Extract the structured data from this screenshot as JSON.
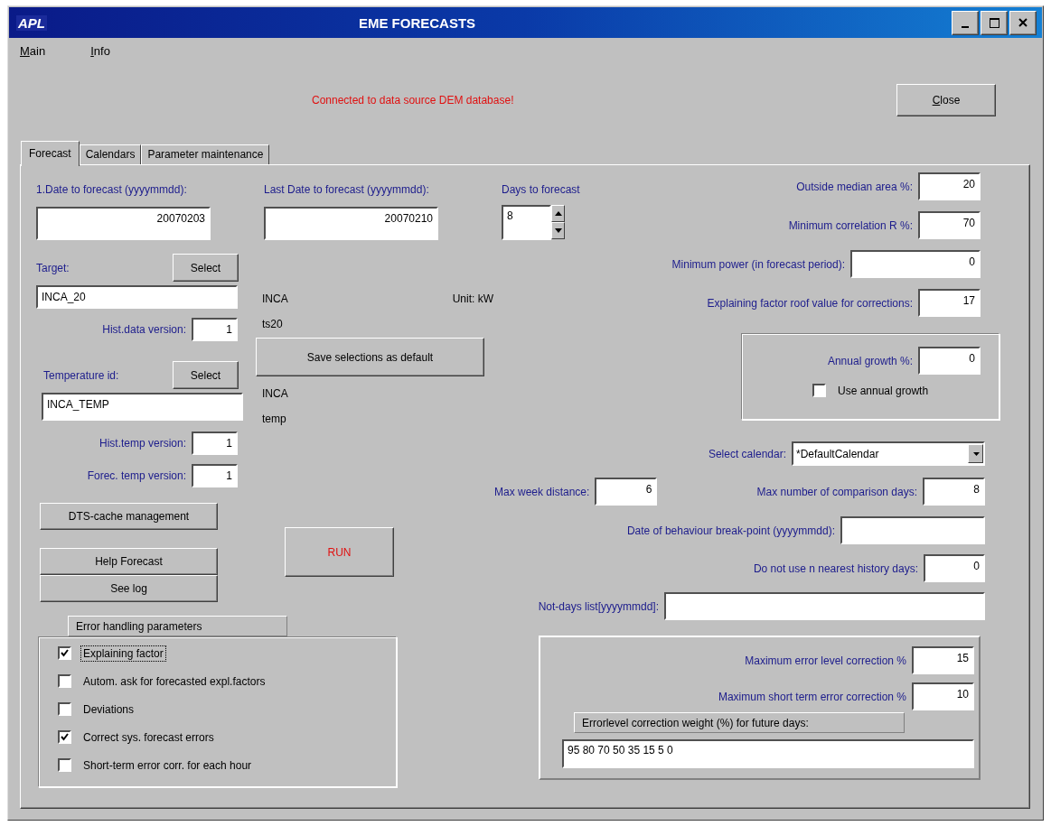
{
  "window": {
    "logo": "APL",
    "title": "EME FORECASTS"
  },
  "menu": [
    {
      "label": "Main"
    },
    {
      "label": "Info"
    }
  ],
  "status_message": "Connected to data source DEM database!",
  "close_button": "Close",
  "tabs": [
    {
      "label": "Forecast",
      "selected": true
    },
    {
      "label": "Calendars",
      "selected": false
    },
    {
      "label": "Parameter maintenance",
      "selected": false
    }
  ],
  "forecast": {
    "first_date": {
      "label": "1.Date to forecast (yyyymmdd):",
      "value": "20070203"
    },
    "last_date": {
      "label": "Last Date to forecast (yyyymmdd):",
      "value": "20070210"
    },
    "days_to_forecast": {
      "label": "Days to forecast",
      "value": "8"
    },
    "target": {
      "label": "Target:",
      "button": "Select",
      "value": "INCA_20",
      "name": "INCA",
      "unit": "Unit: kW",
      "series": "ts20"
    },
    "hist_data_version": {
      "label": "Hist.data version:",
      "value": "1"
    },
    "save_button": "Save selections as default",
    "temperature": {
      "label": "Temperature id:",
      "button": "Select",
      "value": "INCA_TEMP",
      "name": "INCA",
      "series": "temp"
    },
    "hist_temp_version": {
      "label": "Hist.temp version:",
      "value": "1"
    },
    "forec_temp_version": {
      "label": "Forec. temp version:",
      "value": "1"
    },
    "dts_button": "DTS-cache management",
    "help_button": "Help Forecast",
    "log_button": "See log",
    "run_button": "RUN",
    "error_handling": {
      "title": "Error handling parameters",
      "options": [
        {
          "label": "Explaining factor",
          "checked": true,
          "focused": true
        },
        {
          "label": "Autom. ask for forecasted expl.factors",
          "checked": false,
          "focused": false
        },
        {
          "label": "Deviations",
          "checked": false,
          "focused": false
        },
        {
          "label": "Correct sys. forecast errors",
          "checked": true,
          "focused": false
        },
        {
          "label": "Short-term error corr. for each hour",
          "checked": false,
          "focused": false
        }
      ]
    },
    "params": [
      {
        "label": "Outside median area %:",
        "value": "20",
        "kind": "short"
      },
      {
        "label": "Minimum correlation R %:",
        "value": "70",
        "kind": "short"
      },
      {
        "label": "Minimum power (in forecast period):",
        "value": "0",
        "kind": "wide"
      },
      {
        "label": "Explaining factor roof value for corrections:",
        "value": "17",
        "kind": "short"
      }
    ],
    "annual_growth": {
      "label": "Annual growth %:",
      "value": "0",
      "checkbox": {
        "label": "Use annual growth",
        "checked": false
      }
    },
    "calendar": {
      "label": "Select calendar:",
      "value": "*DefaultCalendar"
    },
    "max_week_distance": {
      "label": "Max week distance:",
      "value": "6"
    },
    "max_comparison_days": {
      "label": "Max number of comparison days:",
      "value": "8"
    },
    "history_rows": [
      {
        "label": "Date of behaviour break-point (yyyymmdd):",
        "kind": "wide"
      },
      {
        "label": "Do not use n nearest history days:",
        "value": "0",
        "kind": "short"
      },
      {
        "label": "Not-days list[yyyymmdd]:",
        "kind": "long"
      }
    ],
    "correction": {
      "rows": [
        {
          "label": "Maximum error level correction %",
          "value": "15"
        },
        {
          "label": "Maximum short term error correction %",
          "value": "10"
        }
      ],
      "weight": {
        "label": "Errorlevel correction weight (%) for future days:",
        "value": "95 80 70 50 35 15 5 0"
      }
    }
  }
}
